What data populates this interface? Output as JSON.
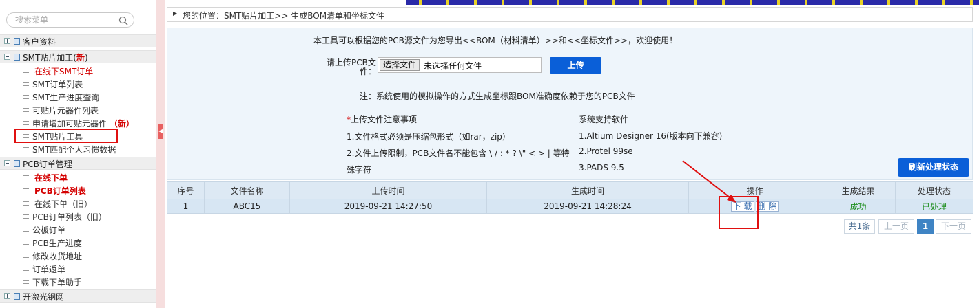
{
  "search": {
    "placeholder": "搜索菜单"
  },
  "sidebar": {
    "groups": [
      {
        "label": "客户资料"
      },
      {
        "label": "SMT贴片加工(",
        "tag": "新",
        "tail": ")"
      },
      {
        "label": "PCB订单管理"
      },
      {
        "label": "开激光钢网"
      }
    ],
    "smt_items": [
      {
        "label": "在线下SMT订单"
      },
      {
        "label": "SMT订单列表"
      },
      {
        "label": "SMT生产进度查询"
      },
      {
        "label": "可贴片元器件列表"
      },
      {
        "label": "申请增加可贴元器件 ",
        "tag": "（新）"
      },
      {
        "label": "SMT贴片工具"
      },
      {
        "label": "SMT匹配个人习惯数据"
      }
    ],
    "pcb_items": [
      {
        "label": "在线下单"
      },
      {
        "label": "PCB订单列表"
      },
      {
        "label": "在线下单（旧）"
      },
      {
        "label": "PCB订单列表（旧）"
      },
      {
        "label": "公板订单"
      },
      {
        "label": "PCB生产进度"
      },
      {
        "label": "修改收货地址"
      },
      {
        "label": "订单返单"
      },
      {
        "label": "下载下单助手"
      }
    ]
  },
  "breadcrumb": {
    "text": "您的位置：SMT贴片加工>> 生成BOM清单和坐标文件"
  },
  "panel": {
    "intro": "本工具可以根据您的PCB源文件为您导出<<BOM（材料清单）>>和<<坐标文件>>，欢迎使用！",
    "upload_label_1": "请上传PCB文",
    "upload_label_2": "件：",
    "file_button": "选择文件",
    "file_status": "未选择任何文件",
    "upload_button": "上传",
    "note": "注：系统使用的模拟操作的方式生成坐标跟BOM准确度依赖于您的PCB文件",
    "notes_star": "*",
    "notes_title": "上传文件注意事项",
    "notes": [
      "1.文件格式必须是压缩包形式（如rar，zip）",
      "2.文件上传限制，PCB文件名不能包含 \\ / : * ? \\\" < > | 等特",
      "殊字符"
    ],
    "software_title": "系统支持软件",
    "software": [
      "1.Altium Designer 16(版本向下兼容)",
      "2.Protel 99se",
      "3.PADS 9.5"
    ],
    "refresh_button": "刷新处理状态"
  },
  "table": {
    "headers": [
      "序号",
      "文件名称",
      "上传时间",
      "生成时间",
      "操作",
      "生成结果",
      "处理状态"
    ],
    "rows": [
      {
        "index": "1",
        "file_name": "ABC15",
        "upload_time": "2019-09-21 14:27:50",
        "gen_time": "2019-09-21 14:28:24",
        "download_label": "下 载",
        "delete_label": "删 除",
        "result": "成功",
        "status": "已处理"
      }
    ]
  },
  "pagination": {
    "total": "共1条",
    "prev": "上一页",
    "current": "1",
    "next": "下一页"
  },
  "colors": {
    "accent_blue": "#0a5fd8",
    "highlight_red": "#e01010",
    "success_green": "#1f8f1f",
    "new_tag_red": "#d40000"
  }
}
